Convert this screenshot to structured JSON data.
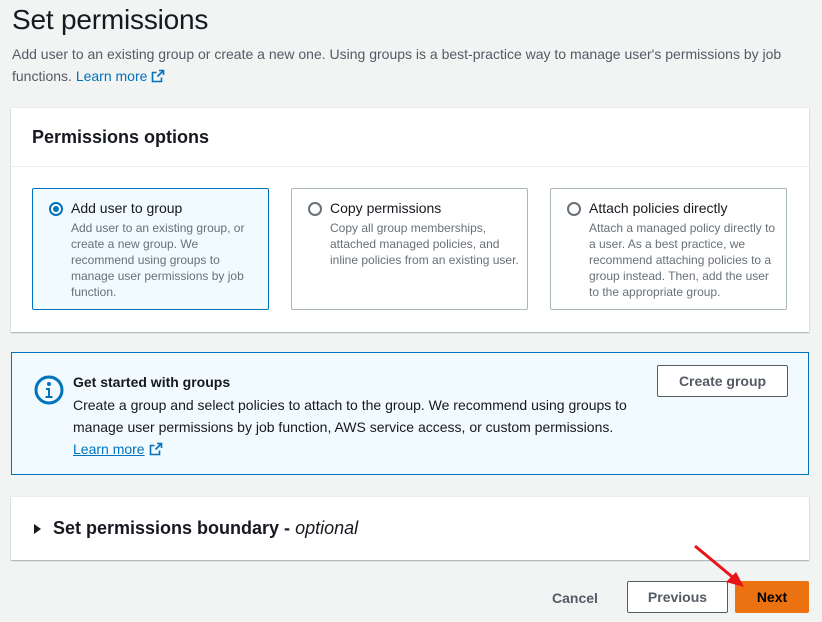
{
  "header": {
    "title": "Set permissions",
    "description": "Add user to an existing group or create a new one. Using groups is a best-practice way to manage user's permissions by job functions.",
    "learn_more": "Learn more"
  },
  "permissions_options": {
    "title": "Permissions options",
    "options": [
      {
        "label": "Add user to group",
        "description": "Add user to an existing group, or create a new group. We recommend using groups to manage user permissions by job function.",
        "selected": true
      },
      {
        "label": "Copy permissions",
        "description": "Copy all group memberships, attached managed policies, and inline policies from an existing user.",
        "selected": false
      },
      {
        "label": "Attach policies directly",
        "description": "Attach a managed policy directly to a user. As a best practice, we recommend attaching policies to a group instead. Then, add the user to the appropriate group.",
        "selected": false
      }
    ]
  },
  "info_panel": {
    "title": "Get started with groups",
    "body": "Create a group and select policies to attach to the group. We recommend using groups to manage user permissions by job function, AWS service access, or custom permissions.",
    "learn_more": "Learn more",
    "create_group_label": "Create group"
  },
  "boundary": {
    "label": "Set permissions boundary - ",
    "optional": "optional"
  },
  "footer": {
    "cancel": "Cancel",
    "previous": "Previous",
    "next": "Next"
  },
  "colors": {
    "accent": "#0073bb",
    "primary_button": "#ec7211",
    "annotation_arrow": "#e8141a"
  },
  "icons": [
    "external-link-icon",
    "info-icon",
    "caret-right-icon",
    "annotation-arrow"
  ]
}
